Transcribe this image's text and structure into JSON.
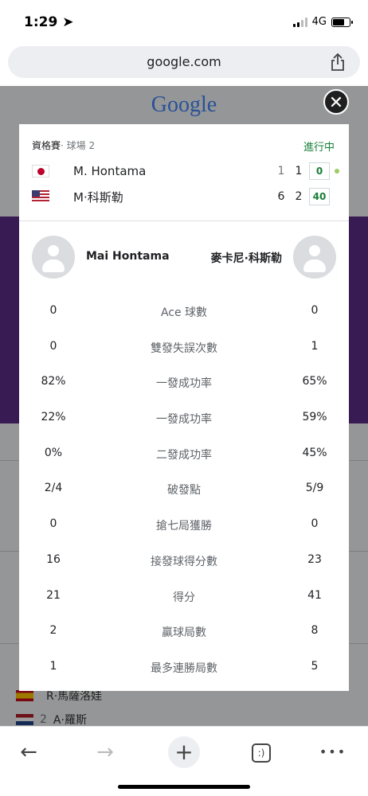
{
  "status_bar": {
    "time": "1:29",
    "network": "4G"
  },
  "browser": {
    "url": "google.com"
  },
  "background_page": {
    "logo": "Google",
    "rows": [
      {
        "seed": "",
        "name": "R·馬薩洛娃"
      },
      {
        "seed": "2",
        "name": "A·羅斯"
      }
    ]
  },
  "match": {
    "round": "資格賽",
    "court": "· 球場 2",
    "status": "進行中",
    "players": [
      {
        "name": "M. Hontama",
        "set1": "1",
        "set2": "1",
        "game": "0",
        "serving": true
      },
      {
        "name": "M·科斯勒",
        "set1": "6",
        "set2": "2",
        "game": "40",
        "serving": false
      }
    ]
  },
  "stats": {
    "left_player": "Mai Hontama",
    "right_player": "麥卡尼·科斯勒",
    "rows": [
      {
        "label": "Ace 球數",
        "left": "0",
        "right": "0"
      },
      {
        "label": "雙發失誤次數",
        "left": "0",
        "right": "1"
      },
      {
        "label": "一發成功率",
        "left": "82%",
        "right": "65%"
      },
      {
        "label": "一發成功率",
        "left": "22%",
        "right": "59%"
      },
      {
        "label": "二發成功率",
        "left": "0%",
        "right": "45%"
      },
      {
        "label": "破發點",
        "left": "2/4",
        "right": "5/9"
      },
      {
        "label": "搶七局獲勝",
        "left": "0",
        "right": "0"
      },
      {
        "label": "接發球得分數",
        "left": "16",
        "right": "23"
      },
      {
        "label": "得分",
        "left": "21",
        "right": "41"
      },
      {
        "label": "贏球局數",
        "left": "2",
        "right": "8"
      },
      {
        "label": "最多連勝局數",
        "left": "1",
        "right": "5"
      }
    ]
  },
  "toolbar": {
    "back": "←",
    "forward": "→",
    "new_tab": "+",
    "tabs": ":)",
    "more": "•••"
  },
  "colors": {
    "live": "#188038",
    "overlay": "rgba(0,0,0,0.38)"
  }
}
